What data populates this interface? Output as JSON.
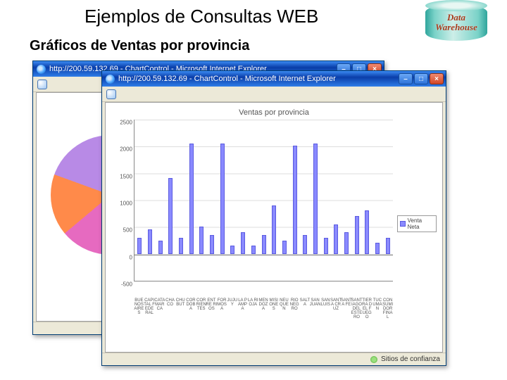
{
  "slide": {
    "title": "Ejemplos de Consultas WEB",
    "subtitle": "Gráficos de Ventas por provincia"
  },
  "badge": {
    "line1": "Data",
    "line2": "Warehouse"
  },
  "window_back": {
    "title": "http://200.59.132.69 - ChartControl - Microsoft Internet Explorer"
  },
  "window_front": {
    "title": "http://200.59.132.69 - ChartControl - Microsoft Internet Explorer",
    "status_text": "Sitios de confianza"
  },
  "chart_data": {
    "type": "bar",
    "title": "Ventas por provincia",
    "ylabel": "",
    "xlabel": "",
    "ylim": [
      -500,
      2500
    ],
    "yticks": [
      -500,
      0,
      500,
      1000,
      1500,
      2000,
      2500
    ],
    "legend": "Venta Neta",
    "categories": [
      "BUENOS AIRES",
      "CAPITAL FEDERAL",
      "CATAMARCA",
      "CHACO",
      "CHUBUT",
      "CORDOBA",
      "CORRIENTES",
      "ENTRE RIOS",
      "FORMOSA",
      "JUJUY",
      "LA PAMPA",
      "LA RIOJA",
      "MENDOZA",
      "MISIONES",
      "NEUQUEN",
      "RIO NEGRO",
      "SALTA",
      "SAN JUAN",
      "SAN LUIS",
      "SANTA CRUZ",
      "SANTA FE",
      "SANTIAGO DEL ESTERO",
      "TIERRA DEL FUEGO",
      "TUCUMAN",
      "CONSUMIDOR FINAL"
    ],
    "values": [
      300,
      450,
      250,
      1400,
      300,
      2050,
      500,
      350,
      2050,
      150,
      400,
      150,
      350,
      900,
      250,
      2000,
      350,
      2050,
      300,
      550,
      400,
      700,
      800,
      200,
      300
    ]
  }
}
